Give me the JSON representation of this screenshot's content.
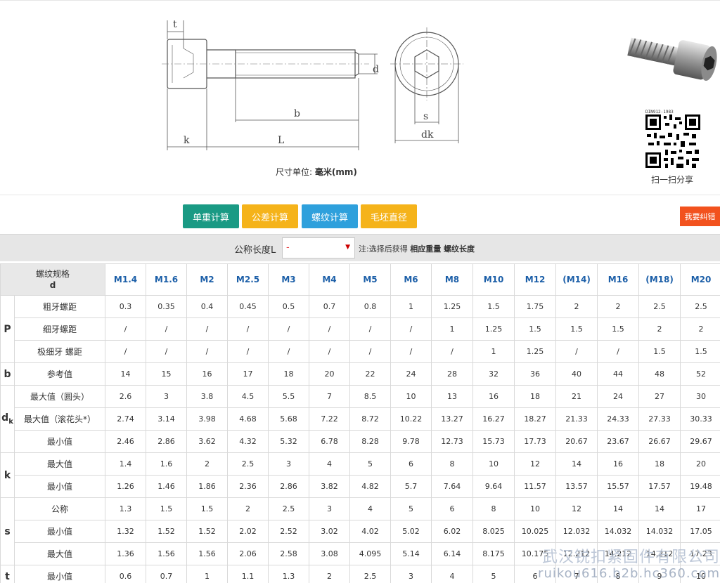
{
  "drawing": {
    "labels": {
      "t": "t",
      "d": "d",
      "b": "b",
      "k": "k",
      "L": "L",
      "s": "s",
      "dk": "dk"
    },
    "unit_caption_prefix": "尺寸单位:",
    "unit_caption_value": "毫米(mm)"
  },
  "qr": {
    "code_text": "DIN912-1983",
    "caption": "扫一扫分享"
  },
  "buttons": [
    {
      "label": "单重计算",
      "color": "#1a9a84"
    },
    {
      "label": "公差计算",
      "color": "#f5b31a"
    },
    {
      "label": "螺纹计算",
      "color": "#2ea0dc"
    },
    {
      "label": "毛坯直径",
      "color": "#f5b31a"
    }
  ],
  "report_button": {
    "label": "我要纠错",
    "color": "#f2521e"
  },
  "length_bar": {
    "label": "公称长度L",
    "selected": "-",
    "note_prefix": "注:选择后获得",
    "note_bold": "相应重量 螺纹长度"
  },
  "table": {
    "corner_line1": "螺纹规格",
    "corner_line2": "d",
    "columns": [
      "M1.4",
      "M1.6",
      "M2",
      "M2.5",
      "M3",
      "M4",
      "M5",
      "M6",
      "M8",
      "M10",
      "M12",
      "(M14)",
      "M16",
      "(M18)",
      "M20"
    ],
    "groups": [
      {
        "symbol": "P",
        "sub": "",
        "rows": [
          {
            "label": "粗牙螺距",
            "values": [
              "0.3",
              "0.35",
              "0.4",
              "0.45",
              "0.5",
              "0.7",
              "0.8",
              "1",
              "1.25",
              "1.5",
              "1.75",
              "2",
              "2",
              "2.5",
              "2.5"
            ]
          },
          {
            "label": "细牙螺距",
            "values": [
              "/",
              "/",
              "/",
              "/",
              "/",
              "/",
              "/",
              "/",
              "1",
              "1.25",
              "1.5",
              "1.5",
              "1.5",
              "2",
              "2"
            ]
          },
          {
            "label": "极细牙 螺距",
            "values": [
              "/",
              "/",
              "/",
              "/",
              "/",
              "/",
              "/",
              "/",
              "/",
              "1",
              "1.25",
              "/",
              "/",
              "1.5",
              "1.5"
            ]
          }
        ]
      },
      {
        "symbol": "b",
        "sub": "",
        "rows": [
          {
            "label": "参考值",
            "values": [
              "14",
              "15",
              "16",
              "17",
              "18",
              "20",
              "22",
              "24",
              "28",
              "32",
              "36",
              "40",
              "44",
              "48",
              "52"
            ]
          }
        ]
      },
      {
        "symbol": "d",
        "sub": "k",
        "rows": [
          {
            "label": "最大值（圆头）",
            "values": [
              "2.6",
              "3",
              "3.8",
              "4.5",
              "5.5",
              "7",
              "8.5",
              "10",
              "13",
              "16",
              "18",
              "21",
              "24",
              "27",
              "30"
            ]
          },
          {
            "label": "最大值（滚花头*）",
            "values": [
              "2.74",
              "3.14",
              "3.98",
              "4.68",
              "5.68",
              "7.22",
              "8.72",
              "10.22",
              "13.27",
              "16.27",
              "18.27",
              "21.33",
              "24.33",
              "27.33",
              "30.33"
            ]
          },
          {
            "label": "最小值",
            "values": [
              "2.46",
              "2.86",
              "3.62",
              "4.32",
              "5.32",
              "6.78",
              "8.28",
              "9.78",
              "12.73",
              "15.73",
              "17.73",
              "20.67",
              "23.67",
              "26.67",
              "29.67"
            ]
          }
        ]
      },
      {
        "symbol": "k",
        "sub": "",
        "rows": [
          {
            "label": "最大值",
            "values": [
              "1.4",
              "1.6",
              "2",
              "2.5",
              "3",
              "4",
              "5",
              "6",
              "8",
              "10",
              "12",
              "14",
              "16",
              "18",
              "20"
            ]
          },
          {
            "label": "最小值",
            "values": [
              "1.26",
              "1.46",
              "1.86",
              "2.36",
              "2.86",
              "3.82",
              "4.82",
              "5.7",
              "7.64",
              "9.64",
              "11.57",
              "13.57",
              "15.57",
              "17.57",
              "19.48"
            ]
          }
        ]
      },
      {
        "symbol": "s",
        "sub": "",
        "rows": [
          {
            "label": "公称",
            "values": [
              "1.3",
              "1.5",
              "1.5",
              "2",
              "2.5",
              "3",
              "4",
              "5",
              "6",
              "8",
              "10",
              "12",
              "14",
              "14",
              "17"
            ]
          },
          {
            "label": "最小值",
            "values": [
              "1.32",
              "1.52",
              "1.52",
              "2.02",
              "2.52",
              "3.02",
              "4.02",
              "5.02",
              "6.02",
              "8.025",
              "10.025",
              "12.032",
              "14.032",
              "14.032",
              "17.05"
            ]
          },
          {
            "label": "最大值",
            "values": [
              "1.36",
              "1.56",
              "1.56",
              "2.06",
              "2.58",
              "3.08",
              "4.095",
              "5.14",
              "6.14",
              "8.175",
              "10.175",
              "12.212",
              "14.212",
              "14.212",
              "17.23"
            ]
          }
        ]
      },
      {
        "symbol": "t",
        "sub": "",
        "rows": [
          {
            "label": "最小值",
            "values": [
              "0.6",
              "0.7",
              "1",
              "1.1",
              "1.3",
              "2",
              "2.5",
              "3",
              "4",
              "5",
              "6",
              "7",
              "8",
              "9",
              "10"
            ]
          }
        ]
      }
    ]
  },
  "watermark": {
    "line1": "武汉锐扣紧固件有限公司",
    "line2": "ruikou616.b2b.hc360.com"
  }
}
